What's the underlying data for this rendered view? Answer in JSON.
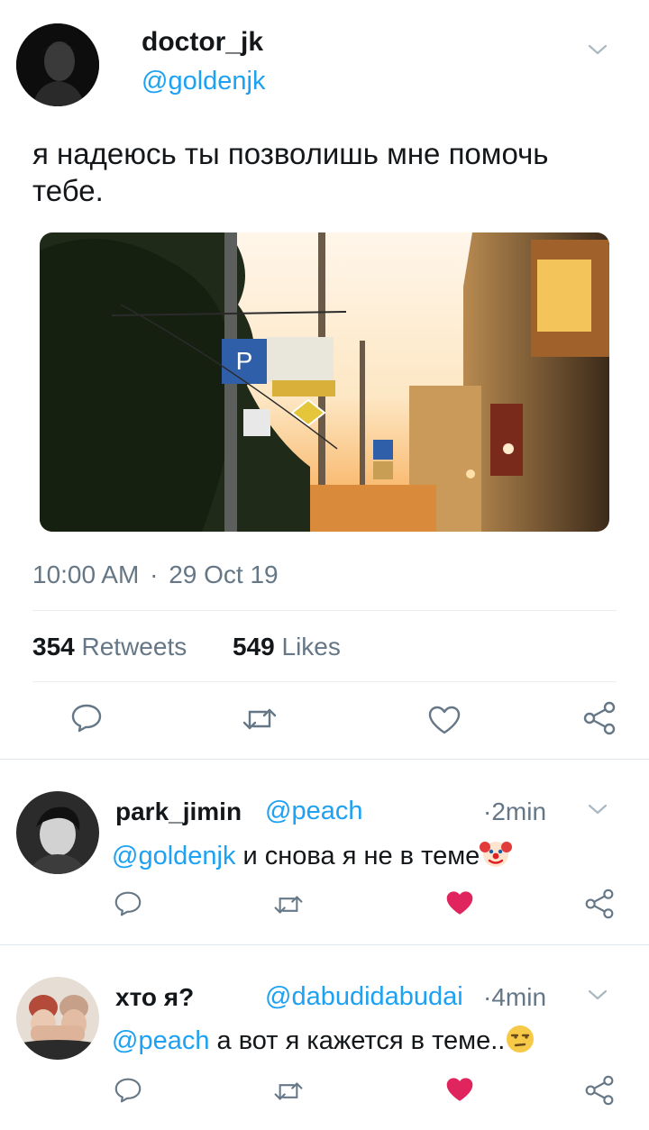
{
  "tweet": {
    "display_name": "doctor_jk",
    "handle": "@goldenjk",
    "text": "я надеюсь ты позволишь мне помочь тебе.",
    "time": "10:00 AM",
    "date": "29 Oct 19",
    "separator": "·",
    "retweets_count": "354",
    "retweets_label": "Retweets",
    "likes_count": "549",
    "likes_label": "Likes"
  },
  "replies": [
    {
      "display_name": "park_jimin",
      "handle": "@peach",
      "time": "2min",
      "mention": "@goldenjk",
      "text": "и снова я не в теме",
      "emoji": "clown-face-icon",
      "liked": true
    },
    {
      "display_name": "хто я?",
      "handle": "@dabudidabudai",
      "time": "4min",
      "mention": "@peach",
      "text": "а вот я кажется в теме..",
      "emoji": "unamused-face-icon",
      "liked": true
    }
  ],
  "colors": {
    "accent": "#1da1f2",
    "muted": "#657786",
    "like_red": "#e0245e",
    "divider": "#e1e8ed"
  }
}
